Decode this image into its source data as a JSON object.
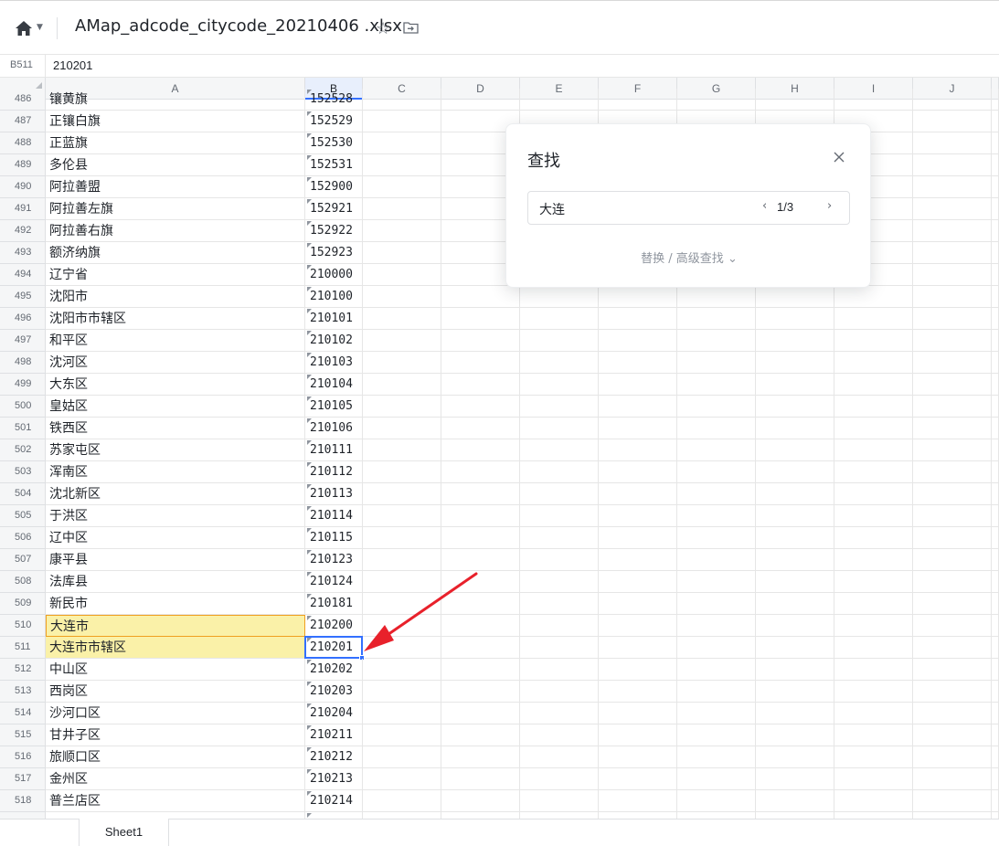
{
  "header": {
    "file_title": "AMap_adcode_citycode_20210406 .xlsx",
    "home_icon": "home-icon",
    "star_icon": "star-icon",
    "move_icon": "move-to-folder-icon"
  },
  "formula_bar": {
    "cell_ref": "B511",
    "value": "210201"
  },
  "columns": [
    "A",
    "B",
    "C",
    "D",
    "E",
    "F",
    "G",
    "H",
    "I",
    "J"
  ],
  "selected_column": "B",
  "partial_top_row": {
    "num": "486",
    "a": "镶黄旗",
    "b": "152528"
  },
  "rows": [
    {
      "num": "487",
      "a": "正镶白旗",
      "b": "152529"
    },
    {
      "num": "488",
      "a": "正蓝旗",
      "b": "152530"
    },
    {
      "num": "489",
      "a": "多伦县",
      "b": "152531"
    },
    {
      "num": "490",
      "a": "阿拉善盟",
      "b": "152900"
    },
    {
      "num": "491",
      "a": "阿拉善左旗",
      "b": "152921"
    },
    {
      "num": "492",
      "a": "阿拉善右旗",
      "b": "152922"
    },
    {
      "num": "493",
      "a": "额济纳旗",
      "b": "152923"
    },
    {
      "num": "494",
      "a": "辽宁省",
      "b": "210000"
    },
    {
      "num": "495",
      "a": "沈阳市",
      "b": "210100"
    },
    {
      "num": "496",
      "a": "沈阳市市辖区",
      "b": "210101"
    },
    {
      "num": "497",
      "a": "和平区",
      "b": "210102"
    },
    {
      "num": "498",
      "a": "沈河区",
      "b": "210103"
    },
    {
      "num": "499",
      "a": "大东区",
      "b": "210104"
    },
    {
      "num": "500",
      "a": "皇姑区",
      "b": "210105"
    },
    {
      "num": "501",
      "a": "铁西区",
      "b": "210106"
    },
    {
      "num": "502",
      "a": "苏家屯区",
      "b": "210111"
    },
    {
      "num": "503",
      "a": "浑南区",
      "b": "210112"
    },
    {
      "num": "504",
      "a": "沈北新区",
      "b": "210113"
    },
    {
      "num": "505",
      "a": "于洪区",
      "b": "210114"
    },
    {
      "num": "506",
      "a": "辽中区",
      "b": "210115"
    },
    {
      "num": "507",
      "a": "康平县",
      "b": "210123"
    },
    {
      "num": "508",
      "a": "法库县",
      "b": "210124"
    },
    {
      "num": "509",
      "a": "新民市",
      "b": "210181"
    },
    {
      "num": "510",
      "a": "大连市",
      "b": "210200",
      "highlight": "active"
    },
    {
      "num": "511",
      "a": "大连市市辖区",
      "b": "210201",
      "highlight": "match",
      "selected": true
    },
    {
      "num": "512",
      "a": "中山区",
      "b": "210202"
    },
    {
      "num": "513",
      "a": "西岗区",
      "b": "210203"
    },
    {
      "num": "514",
      "a": "沙河口区",
      "b": "210204"
    },
    {
      "num": "515",
      "a": "甘井子区",
      "b": "210211"
    },
    {
      "num": "516",
      "a": "旅顺口区",
      "b": "210212"
    },
    {
      "num": "517",
      "a": "金州区",
      "b": "210213"
    },
    {
      "num": "518",
      "a": "普兰店区",
      "b": "210214"
    }
  ],
  "find_dialog": {
    "title": "查找",
    "query": "大连",
    "match_count": "1/3",
    "advanced_label": "替换 / 高级查找",
    "close_icon": "close-icon"
  },
  "sheet_tabs": [
    "Sheet1"
  ],
  "colors": {
    "selection": "#3370ff",
    "match_highlight": "#faf1a8",
    "active_match_border": "#f0a020",
    "annotation_arrow": "#e8212b"
  }
}
